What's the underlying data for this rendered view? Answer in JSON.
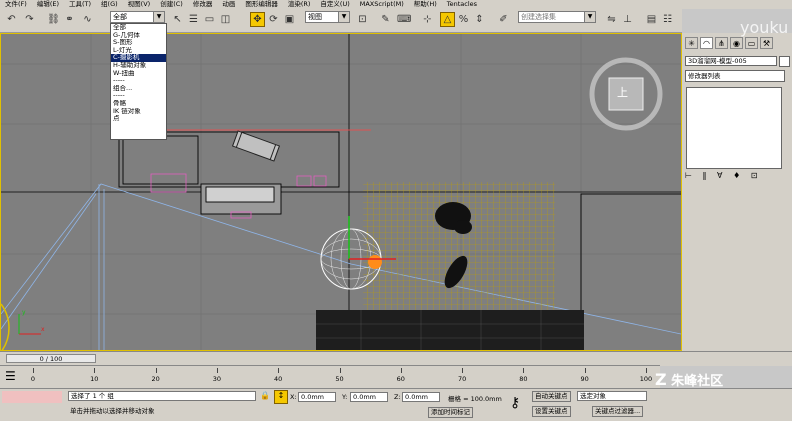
{
  "menubar": {
    "items": [
      "文件(F)",
      "编辑(E)",
      "工具(T)",
      "组(G)",
      "视图(V)",
      "创建(C)",
      "修改器",
      "动画",
      "图形编辑器",
      "渲染(R)",
      "自定义(U)",
      "MAXScript(M)",
      "帮助(H)",
      "Tentacles"
    ]
  },
  "toolbar": {
    "selection_filter": "全部",
    "view_dropdown": "视图",
    "named_selection_placeholder": "创建选择集"
  },
  "dropdown": {
    "items": [
      "全部",
      "G-几何体",
      "S-图形",
      "L-灯光",
      "C-摄影机",
      "H-辅助对象",
      "W-扭曲",
      "-----",
      "组合...",
      "-----",
      "骨骼",
      "IK 链对象",
      "点"
    ],
    "highlighted_index": 4
  },
  "viewport": {
    "viewcube_label": "上",
    "axis_x": "x",
    "axis_y": "y"
  },
  "right_panel": {
    "object_name": "3D溜溜网-模型-005",
    "modifier_list": "修改器列表"
  },
  "timeline": {
    "frame_display": "0 / 100",
    "ticks": [
      0,
      10,
      20,
      30,
      40,
      50,
      60,
      70,
      80,
      90,
      100
    ]
  },
  "status": {
    "selection_info": "选择了 1 个 组",
    "prompt": "单击并拖动以选择并移动对象",
    "x_label": "X:",
    "x_value": "0.0mm",
    "y_label": "Y:",
    "y_value": "0.0mm",
    "z_label": "Z:",
    "z_value": "0.0mm",
    "grid_label": "栅格 = 100.0mm",
    "auto_key": "自动关键点",
    "set_key": "设置关键点",
    "key_mode": "选定对象",
    "key_filters": "关键点过滤器...",
    "add_time_tag": "添加时间标记"
  },
  "watermark": {
    "text": "朱峰社区",
    "sub": "youku"
  }
}
